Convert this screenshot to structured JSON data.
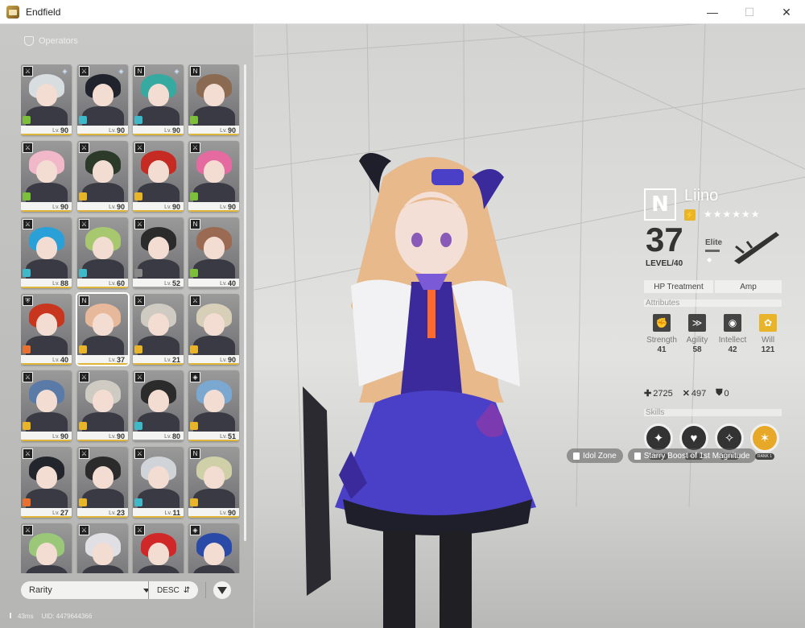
{
  "window": {
    "title": "Endfield",
    "icon": "app-icon"
  },
  "window_controls": {
    "minimize": "—",
    "maximize": "☐",
    "close": "✕"
  },
  "left_panel": {
    "header": "Operators",
    "cards": [
      {
        "level": "90",
        "cls": "⚔",
        "hair": "#d8dde0",
        "el": "#7cbf3a",
        "bar": "#e0b63a",
        "pot": "◈"
      },
      {
        "level": "90",
        "cls": "⚔",
        "hair": "#20232b",
        "el": "#3fb8c8",
        "bar": "#e0b63a",
        "pot": "◈"
      },
      {
        "level": "90",
        "cls": "N",
        "hair": "#36a9a0",
        "el": "#3fb8c8",
        "bar": "#e0b63a",
        "pot": "◈"
      },
      {
        "level": "90",
        "cls": "N",
        "hair": "#8b6a52",
        "el": "#7cbf3a",
        "bar": "#e0b63a",
        "pot": ""
      },
      {
        "level": "90",
        "cls": "⚔",
        "hair": "#f0b8c8",
        "el": "#7cbf3a",
        "bar": "#e0b63a",
        "pot": ""
      },
      {
        "level": "90",
        "cls": "⚔",
        "hair": "#2c3a2a",
        "el": "#e8b42a",
        "bar": "#e0b63a",
        "pot": ""
      },
      {
        "level": "90",
        "cls": "⚔",
        "hair": "#c52b22",
        "el": "#e8b42a",
        "bar": "#e0b63a",
        "pot": ""
      },
      {
        "level": "90",
        "cls": "⚔",
        "hair": "#e56aa0",
        "el": "#7cbf3a",
        "bar": "#e0b63a",
        "pot": ""
      },
      {
        "level": "88",
        "cls": "⚔",
        "hair": "#2aa0d8",
        "el": "#3fb8c8",
        "bar": "#e0b63a",
        "pot": ""
      },
      {
        "level": "60",
        "cls": "⚔",
        "hair": "#a8c870",
        "el": "#3fb8c8",
        "bar": "#e0b63a",
        "pot": ""
      },
      {
        "level": "52",
        "cls": "⚔",
        "hair": "#2b2b2b",
        "el": "#888888",
        "bar": "#a0a0a0",
        "pot": ""
      },
      {
        "level": "40",
        "cls": "N",
        "hair": "#9a6a52",
        "el": "#7cbf3a",
        "bar": "#a0a0a0",
        "pot": ""
      },
      {
        "level": "40",
        "cls": "⛨",
        "hair": "#c8361e",
        "el": "#e87030",
        "bar": "#e0b63a",
        "pot": ""
      },
      {
        "level": "37",
        "cls": "N",
        "hair": "#e8b89a",
        "el": "#e8b42a",
        "bar": "#e0b63a",
        "pot": ""
      },
      {
        "level": "21",
        "cls": "⚔",
        "hair": "#cfcac2",
        "el": "#e8b42a",
        "bar": "#e0b63a",
        "pot": ""
      },
      {
        "level": "90",
        "cls": "⚔",
        "hair": "#d8cfb8",
        "el": "#e8b42a",
        "bar": "#e0b63a",
        "pot": ""
      },
      {
        "level": "90",
        "cls": "⚔",
        "hair": "#5a7aa8",
        "el": "#e8b42a",
        "bar": "#e0b63a",
        "pot": ""
      },
      {
        "level": "90",
        "cls": "⚔",
        "hair": "#cfcac2",
        "el": "#e8b42a",
        "bar": "#e0b63a",
        "pot": ""
      },
      {
        "level": "80",
        "cls": "⚔",
        "hair": "#2b2b2b",
        "el": "#3fb8c8",
        "bar": "#a0a0a0",
        "pot": ""
      },
      {
        "level": "51",
        "cls": "◈",
        "hair": "#7aa8d0",
        "el": "#e8b42a",
        "bar": "#e0b63a",
        "pot": ""
      },
      {
        "level": "27",
        "cls": "⚔",
        "hair": "#23252d",
        "el": "#e87030",
        "bar": "#e0b63a",
        "pot": ""
      },
      {
        "level": "23",
        "cls": "⚔",
        "hair": "#2b2b2b",
        "el": "#e8b42a",
        "bar": "#e0b63a",
        "pot": ""
      },
      {
        "level": "11",
        "cls": "⚔",
        "hair": "#d0d4d8",
        "el": "#3fb8c8",
        "bar": "#e0b63a",
        "pot": ""
      },
      {
        "level": "90",
        "cls": "N",
        "hair": "#cfcfa8",
        "el": "#e8b42a",
        "bar": "#e0b63a",
        "pot": ""
      },
      {
        "level": "",
        "cls": "⚔",
        "hair": "#9ac878",
        "el": "#7cbf3a",
        "bar": "#e0b63a",
        "pot": ""
      },
      {
        "level": "",
        "cls": "⚔",
        "hair": "#e0e0e4",
        "el": "#7cbf3a",
        "bar": "#e0b63a",
        "pot": ""
      },
      {
        "level": "",
        "cls": "⚔",
        "hair": "#d02828",
        "el": "#e87030",
        "bar": "#e0b63a",
        "pot": ""
      },
      {
        "level": "",
        "cls": "◈",
        "hair": "#2a4aa8",
        "el": "#3fb8c8",
        "bar": "#e0b63a",
        "pot": ""
      }
    ],
    "selected_index": 13,
    "sort": {
      "field": "Rarity",
      "order": "DESC"
    },
    "status": {
      "ping": "43ms",
      "uid": "UID: 4479644366"
    }
  },
  "operator": {
    "class_badge": "N",
    "name": "Liino",
    "stars": "★★★★★★",
    "level": "37",
    "level_label": "LEVEL/40",
    "elite_label": "Elite",
    "tags": [
      "HP Treatment",
      "Amp"
    ],
    "attributes_header": "Attributes",
    "attributes": [
      {
        "name": "Strength",
        "value": "41",
        "icon": "✊"
      },
      {
        "name": "Agility",
        "value": "58",
        "icon": "≫"
      },
      {
        "name": "Intellect",
        "value": "42",
        "icon": "◉"
      },
      {
        "name": "Will",
        "value": "121",
        "icon": "✿"
      }
    ],
    "stats": {
      "hp": "2725",
      "atk": "497",
      "def": "0"
    },
    "skills_header": "Skills",
    "skills": [
      {
        "icon": "✦",
        "rank": "RANK 1"
      },
      {
        "icon": "♥",
        "rank": "RANK 1"
      },
      {
        "icon": "✧",
        "rank": "RANK 1"
      },
      {
        "icon": "✶",
        "rank": "RANK 1"
      }
    ]
  },
  "chips": {
    "talent1": "Idol Zone",
    "talent2": "Starry Boost of 1st Magnitude"
  },
  "colors": {
    "accent": "#e8b42a",
    "outfit": "#3b2a9c",
    "panel_bg": "#c2c2c0"
  }
}
